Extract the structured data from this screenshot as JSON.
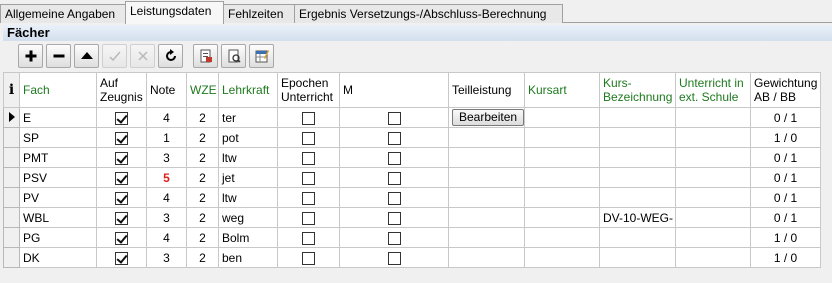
{
  "tabs": [
    {
      "label": "Allgemeine Angaben"
    },
    {
      "label": "Leistungsdaten"
    },
    {
      "label": "Fehlzeiten"
    },
    {
      "label": "Ergebnis Versetzungs-/Abschluss-Berechnung"
    }
  ],
  "active_tab": "Leistungsdaten",
  "section_title": "Fächer",
  "toolbar": [
    {
      "icon": "plus-icon",
      "enabled": true
    },
    {
      "icon": "minus-icon",
      "enabled": true
    },
    {
      "icon": "arrow-up-icon",
      "enabled": true
    },
    {
      "icon": "checkmark-icon",
      "enabled": false
    },
    {
      "icon": "cancel-icon",
      "enabled": false
    },
    {
      "icon": "refresh-icon",
      "enabled": true
    },
    {
      "icon": "report-icon",
      "enabled": true
    },
    {
      "icon": "print-preview-icon",
      "enabled": true
    },
    {
      "icon": "edit-table-icon",
      "enabled": true
    }
  ],
  "grid": {
    "info_header": "i",
    "columns": {
      "fach": "Fach",
      "auf_zeugnis": "Auf Zeugnis",
      "note": "Note",
      "wze": "WZE",
      "lehrkraft": "Lehrkraft",
      "epochen": "Epochen Unterricht",
      "m": "M",
      "teilleistung": "Teilleistung",
      "kursart": "Kursart",
      "kurs_bezeichnung": "Kurs-Bezeichnung",
      "unterricht_ext": "Unterricht in ext. Schule",
      "gewichtung": "Gewichtung AB / BB"
    },
    "teilleistung_button": "Bearbeiten",
    "rows": [
      {
        "fach": "E",
        "auf_zeugnis": true,
        "note": "4",
        "note_red": false,
        "wze": "2",
        "lehrkraft": "ter",
        "epochen": false,
        "m": false,
        "teilleistung_button": true,
        "kursart": "",
        "kurs_bezeichnung": "",
        "unterricht_ext": "",
        "gewichtung": "0 / 1",
        "current": true
      },
      {
        "fach": "SP",
        "auf_zeugnis": true,
        "note": "1",
        "note_red": false,
        "wze": "2",
        "lehrkraft": "pot",
        "epochen": false,
        "m": false,
        "teilleistung_button": false,
        "kursart": "",
        "kurs_bezeichnung": "",
        "unterricht_ext": "",
        "gewichtung": "1 / 0",
        "current": false
      },
      {
        "fach": "PMT",
        "auf_zeugnis": true,
        "note": "3",
        "note_red": false,
        "wze": "2",
        "lehrkraft": "ltw",
        "epochen": false,
        "m": false,
        "teilleistung_button": false,
        "kursart": "",
        "kurs_bezeichnung": "",
        "unterricht_ext": "",
        "gewichtung": "0 / 1",
        "current": false
      },
      {
        "fach": "PSV",
        "auf_zeugnis": true,
        "note": "5",
        "note_red": true,
        "wze": "2",
        "lehrkraft": "jet",
        "epochen": false,
        "m": false,
        "teilleistung_button": false,
        "kursart": "",
        "kurs_bezeichnung": "",
        "unterricht_ext": "",
        "gewichtung": "0 / 1",
        "current": false
      },
      {
        "fach": "PV",
        "auf_zeugnis": true,
        "note": "4",
        "note_red": false,
        "wze": "2",
        "lehrkraft": "ltw",
        "epochen": false,
        "m": false,
        "teilleistung_button": false,
        "kursart": "",
        "kurs_bezeichnung": "",
        "unterricht_ext": "",
        "gewichtung": "0 / 1",
        "current": false
      },
      {
        "fach": "WBL",
        "auf_zeugnis": true,
        "note": "3",
        "note_red": false,
        "wze": "2",
        "lehrkraft": "weg",
        "epochen": false,
        "m": false,
        "teilleistung_button": false,
        "kursart": "",
        "kurs_bezeichnung": "DV-10-WEG-",
        "unterricht_ext": "",
        "gewichtung": "0 / 1",
        "current": false
      },
      {
        "fach": "PG",
        "auf_zeugnis": true,
        "note": "4",
        "note_red": false,
        "wze": "2",
        "lehrkraft": "Bolm",
        "epochen": false,
        "m": false,
        "teilleistung_button": false,
        "kursart": "",
        "kurs_bezeichnung": "",
        "unterricht_ext": "",
        "gewichtung": "1 / 0",
        "current": false
      },
      {
        "fach": "DK",
        "auf_zeugnis": true,
        "note": "3",
        "note_red": false,
        "wze": "2",
        "lehrkraft": "ben",
        "epochen": false,
        "m": false,
        "teilleistung_button": false,
        "kursart": "",
        "kurs_bezeichnung": "",
        "unterricht_ext": "",
        "gewichtung": "1 / 0",
        "current": false
      }
    ]
  }
}
